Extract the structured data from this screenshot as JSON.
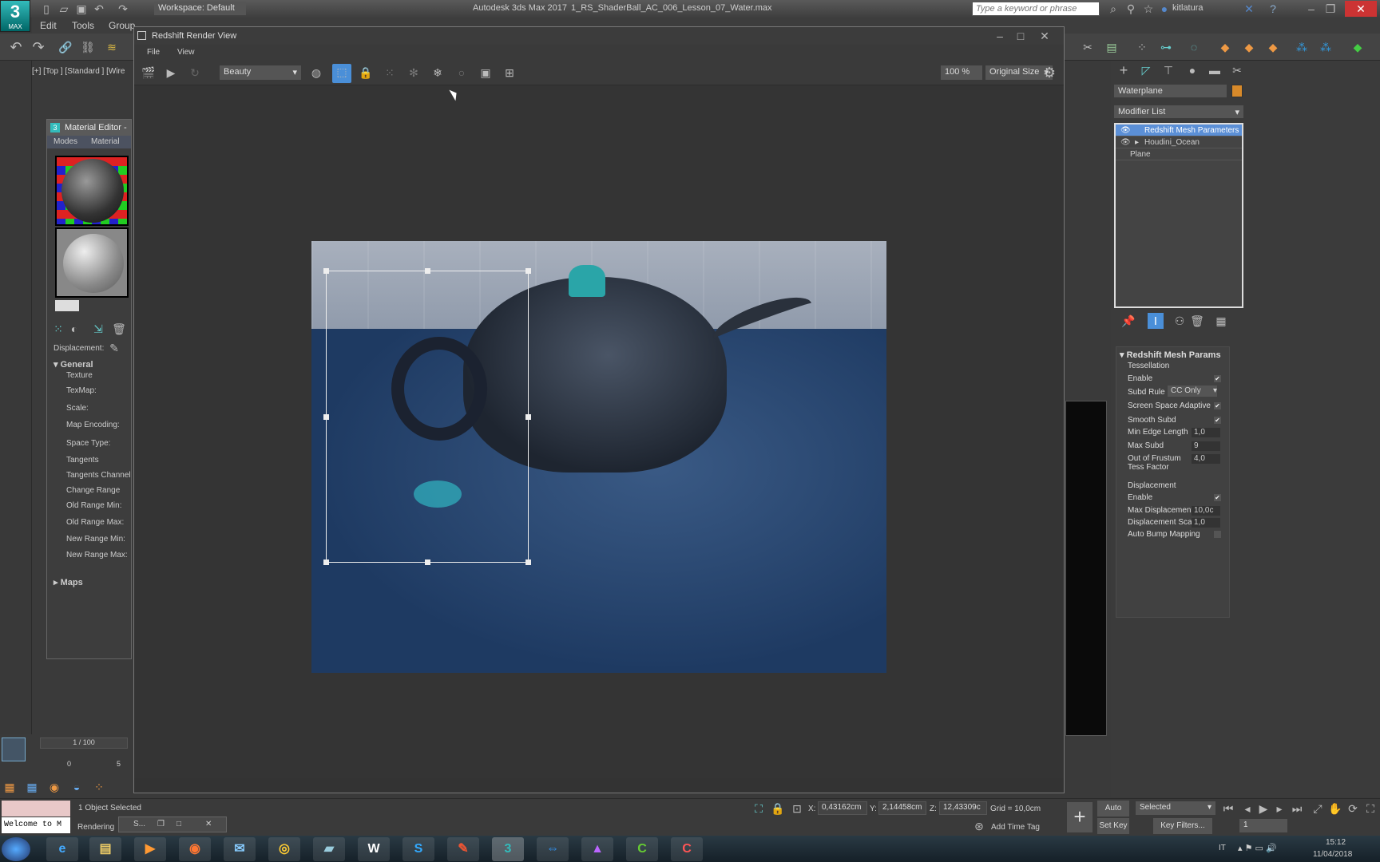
{
  "app": {
    "logo": "3",
    "logo_sub": "MAX",
    "workspace": "Workspace: Default",
    "title": "Autodesk 3ds Max 2017",
    "file": "1_RS_ShaderBall_AC_006_Lesson_07_Water.max",
    "search_placeholder": "Type a keyword or phrase",
    "user": "kitlatura"
  },
  "menu": [
    "Edit",
    "Tools",
    "Group"
  ],
  "viewport_label": "[+] [Top ] [Standard ] [Wire",
  "render_view": {
    "title": "Redshift Render View",
    "menu": [
      "File",
      "View"
    ],
    "aov": "Beauty",
    "zoom": "100 %",
    "size": "Original Size"
  },
  "material_editor": {
    "title": "Material Editor -",
    "menu": [
      "Modes",
      "Material"
    ],
    "displacement": "Displacement:",
    "general": "General",
    "fields": [
      "Texture",
      "TexMap:",
      "Scale:",
      "Map Encoding:",
      "Space Type:",
      "Tangents",
      "Tangents Channel:",
      "Change Range",
      "Old Range Min:",
      "Old Range Max:",
      "New Range Min:",
      "New Range Max:"
    ],
    "maps": "Maps"
  },
  "command_panel": {
    "object_name": "Waterplane",
    "object_color": "#d88a2a",
    "modifier_list": "Modifier List",
    "stack": [
      "Redshift Mesh Parameters",
      "Houdini_Ocean",
      "Plane"
    ],
    "rollout": {
      "title": "Redshift Mesh Params",
      "tessellation": "Tessellation",
      "enable": "Enable",
      "subd_rule": "Subd Rule",
      "subd_rule_value": "CC Only",
      "screen_space": "Screen Space Adaptive",
      "smooth_subd": "Smooth Subd",
      "min_edge": "Min Edge Length",
      "min_edge_value": "1,0",
      "max_subd": "Max Subd",
      "max_subd_value": "9",
      "oof": "Out of Frustum",
      "oof2": "Tess Factor",
      "oof_value": "4,0",
      "displacement": "Displacement",
      "disp_enable": "Enable",
      "max_disp": "Max Displacement",
      "max_disp_value": "10,0c",
      "disp_scale": "Displacement Scale",
      "disp_scale_value": "1,0",
      "auto_bump": "Auto Bump Mapping"
    }
  },
  "timeline": {
    "frame": "1 / 100",
    "ticks": [
      "0",
      "5"
    ]
  },
  "status": {
    "selected": "1 Object Selected",
    "rendering": "Rendering",
    "welcome": "Welcome to M",
    "task": "S...",
    "x_label": "X:",
    "x": "0,43162cm",
    "y_label": "Y:",
    "y": "2,14458cm",
    "z_label": "Z:",
    "z": "12,43309c",
    "grid": "Grid = 10,0cm",
    "add_time_tag": "Add Time Tag",
    "auto_key": "Auto Key",
    "set_key": "Set Key",
    "selected_dd": "Selected",
    "key_filters": "Key Filters...",
    "frame_field": "1"
  },
  "taskbar": {
    "lang": "IT",
    "time": "15:12",
    "date": "11/04/2018"
  }
}
